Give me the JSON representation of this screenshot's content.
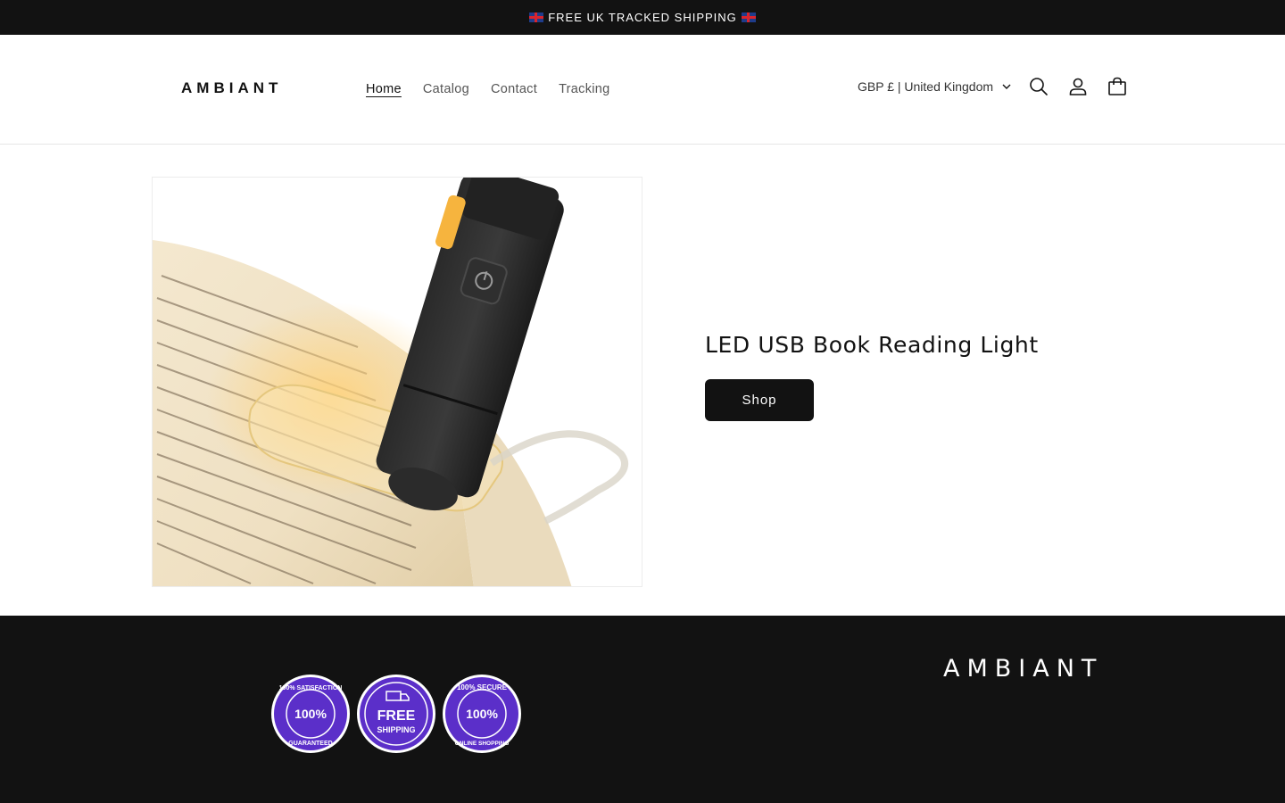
{
  "announcement": {
    "text": "FREE UK TRACKED SHIPPING"
  },
  "header": {
    "logo": "AMBIANT",
    "nav": [
      {
        "label": "Home",
        "active": true
      },
      {
        "label": "Catalog",
        "active": false
      },
      {
        "label": "Contact",
        "active": false
      },
      {
        "label": "Tracking",
        "active": false
      }
    ],
    "locale": "GBP £ | United Kingdom"
  },
  "hero": {
    "title": "LED USB Book Reading Light",
    "button_label": "Shop"
  },
  "footer": {
    "logo": "AMBIANT",
    "badges": [
      {
        "top": "100% SATISFACTION",
        "mid": "100%",
        "bottom": "GUARANTEED"
      },
      {
        "top": "",
        "mid": "FREE",
        "bottom": "SHIPPING"
      },
      {
        "top": "100% SECURE",
        "mid": "100%",
        "bottom": "ONLINE SHOPPING"
      }
    ]
  },
  "colors": {
    "dark": "#121212",
    "badge_purple": "#5b2fc9",
    "white": "#ffffff"
  }
}
